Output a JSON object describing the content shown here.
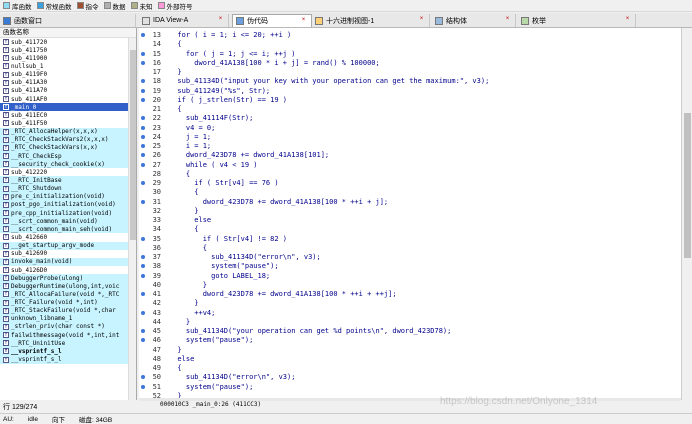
{
  "legend": [
    {
      "label": "库函数",
      "color": "#8fdcf5"
    },
    {
      "label": "常规函数",
      "color": "#3aa0e0"
    },
    {
      "label": "指令",
      "color": "#a05030"
    },
    {
      "label": "数据",
      "color": "#b0b0b0"
    },
    {
      "label": "未知",
      "color": "#b0b088"
    },
    {
      "label": "外部符号",
      "color": "#ff9ad8"
    }
  ],
  "tabs": [
    {
      "label": "函数窗口",
      "icon": "function-window-icon"
    },
    {
      "label": "IDA View-A",
      "icon": "ida-view-icon"
    },
    {
      "label": "伪代码",
      "icon": "pseudocode-icon"
    },
    {
      "label": "十六进制视图-1",
      "icon": "hex-view-icon"
    },
    {
      "label": "结构体",
      "icon": "structures-icon"
    },
    {
      "label": "枚举",
      "icon": "enums-icon"
    }
  ],
  "functions_panel": {
    "header": "函数名称",
    "items": [
      {
        "name": "sub_411720",
        "kind": "normal"
      },
      {
        "name": "sub_411750",
        "kind": "normal"
      },
      {
        "name": "sub_411900",
        "kind": "normal"
      },
      {
        "name": "nullsub_1",
        "kind": "normal"
      },
      {
        "name": "sub_4119F0",
        "kind": "normal"
      },
      {
        "name": "sub_411A30",
        "kind": "normal"
      },
      {
        "name": "sub_411A70",
        "kind": "normal"
      },
      {
        "name": "sub_411AF0",
        "kind": "normal"
      },
      {
        "name": "_main_0",
        "kind": "selected"
      },
      {
        "name": "sub_411EC0",
        "kind": "normal"
      },
      {
        "name": "sub_411F50",
        "kind": "normal"
      },
      {
        "name": "_RTC_AllocaHelper(x,x,x)",
        "kind": "lib"
      },
      {
        "name": "_RTC_CheckStackVars2(x,x,x)",
        "kind": "lib"
      },
      {
        "name": "_RTC_CheckStackVars(x,x)",
        "kind": "lib"
      },
      {
        "name": "__RTC_CheckEsp",
        "kind": "lib"
      },
      {
        "name": "__security_check_cookie(x)",
        "kind": "lib"
      },
      {
        "name": "sub_412220",
        "kind": "normal"
      },
      {
        "name": "__RTC_InitBase",
        "kind": "lib"
      },
      {
        "name": "__RTC_Shutdown",
        "kind": "lib"
      },
      {
        "name": "pre_c_initialization(void)",
        "kind": "lib"
      },
      {
        "name": "post_pgo_initialization(void)",
        "kind": "lib"
      },
      {
        "name": "pre_cpp_initialization(void)",
        "kind": "lib"
      },
      {
        "name": "__scrt_common_main(void)",
        "kind": "lib"
      },
      {
        "name": "__scrt_common_main_seh(void)",
        "kind": "lib"
      },
      {
        "name": "sub_412660",
        "kind": "normal"
      },
      {
        "name": "__get_startup_argv_mode",
        "kind": "lib"
      },
      {
        "name": "sub_412690",
        "kind": "normal"
      },
      {
        "name": "invoke_main(void)",
        "kind": "lib"
      },
      {
        "name": "sub_4126D0",
        "kind": "normal"
      },
      {
        "name": "DebuggerProbe(ulong)",
        "kind": "lib"
      },
      {
        "name": "DebuggerRuntime(ulong,int,voic",
        "kind": "lib"
      },
      {
        "name": "_RTC_AllocaFailure(void *,_RTC",
        "kind": "lib"
      },
      {
        "name": "_RTC_Failure(void *,int)",
        "kind": "lib"
      },
      {
        "name": "_RTC_StackFailure(void *,char",
        "kind": "lib"
      },
      {
        "name": "unknown_libname_1",
        "kind": "lib"
      },
      {
        "name": "_strlen_priv(char const *)",
        "kind": "lib"
      },
      {
        "name": "failwithmessage(void *,int,int",
        "kind": "lib"
      },
      {
        "name": "__RTC_UninitUse",
        "kind": "lib"
      },
      {
        "name": "__vsprintf_s_l",
        "kind": "bold"
      },
      {
        "name": "__vsprintf_s_l",
        "kind": "lib"
      }
    ],
    "row_count": "行 129/274"
  },
  "code_lines": [
    {
      "n": "13",
      "dot": true,
      "t": "  for ( i = 1; i <= 20; ++i )"
    },
    {
      "n": "14",
      "dot": false,
      "t": "  {"
    },
    {
      "n": "15",
      "dot": true,
      "t": "    for ( j = 1; j <= i; ++j )"
    },
    {
      "n": "16",
      "dot": true,
      "t": "      dword_41A138[100 * i + j] = rand() % 100000;"
    },
    {
      "n": "17",
      "dot": false,
      "t": "  }"
    },
    {
      "n": "18",
      "dot": true,
      "t": "  sub_41134D(\"input your key with your operation can get the maximum:\", v3);"
    },
    {
      "n": "19",
      "dot": true,
      "t": "  sub_411249(\"%s\", Str);"
    },
    {
      "n": "20",
      "dot": true,
      "t": "  if ( j_strlen(Str) == 19 )"
    },
    {
      "n": "21",
      "dot": false,
      "t": "  {"
    },
    {
      "n": "22",
      "dot": true,
      "t": "    sub_41114F(Str);"
    },
    {
      "n": "23",
      "dot": true,
      "t": "    v4 = 0;"
    },
    {
      "n": "24",
      "dot": true,
      "t": "    j = 1;"
    },
    {
      "n": "25",
      "dot": true,
      "t": "    i = 1;"
    },
    {
      "n": "26",
      "dot": true,
      "t": "    dword_423D78 += dword_41A138[101];"
    },
    {
      "n": "27",
      "dot": true,
      "t": "    while ( v4 < 19 )"
    },
    {
      "n": "28",
      "dot": false,
      "t": "    {"
    },
    {
      "n": "29",
      "dot": true,
      "t": "      if ( Str[v4] == 76 )"
    },
    {
      "n": "30",
      "dot": false,
      "t": "      {"
    },
    {
      "n": "31",
      "dot": true,
      "t": "        dword_423D78 += dword_41A138[100 * ++i + j];"
    },
    {
      "n": "32",
      "dot": false,
      "t": "      }"
    },
    {
      "n": "33",
      "dot": false,
      "t": "      else"
    },
    {
      "n": "34",
      "dot": false,
      "t": "      {"
    },
    {
      "n": "35",
      "dot": true,
      "t": "        if ( Str[v4] != 82 )"
    },
    {
      "n": "36",
      "dot": false,
      "t": "        {"
    },
    {
      "n": "37",
      "dot": true,
      "t": "          sub_41134D(\"error\\n\", v3);"
    },
    {
      "n": "38",
      "dot": true,
      "t": "          system(\"pause\");"
    },
    {
      "n": "39",
      "dot": true,
      "t": "          goto LABEL_18;"
    },
    {
      "n": "40",
      "dot": false,
      "t": "        }"
    },
    {
      "n": "41",
      "dot": true,
      "t": "        dword_423D78 += dword_41A138[100 * ++i + ++j];"
    },
    {
      "n": "42",
      "dot": false,
      "t": "      }"
    },
    {
      "n": "43",
      "dot": true,
      "t": "      ++v4;"
    },
    {
      "n": "44",
      "dot": false,
      "t": "    }"
    },
    {
      "n": "45",
      "dot": true,
      "t": "    sub_41134D(\"your operation can get %d points\\n\", dword_423D78);"
    },
    {
      "n": "46",
      "dot": true,
      "t": "    system(\"pause\");"
    },
    {
      "n": "47",
      "dot": false,
      "t": "  }"
    },
    {
      "n": "48",
      "dot": false,
      "t": "  else"
    },
    {
      "n": "49",
      "dot": false,
      "t": "  {"
    },
    {
      "n": "50",
      "dot": true,
      "t": "    sub_41134D(\"error\\n\", v3);"
    },
    {
      "n": "51",
      "dot": true,
      "t": "    system(\"pause\");"
    },
    {
      "n": "52",
      "dot": false,
      "t": "  }"
    }
  ],
  "address_line": "000010C3 _main_0:26 (411CC3)",
  "status": {
    "au": "AU:",
    "idle": "idle",
    "direction": "向下",
    "disk": "磁盘: 34GB"
  },
  "watermark": "https://blog.csdn.net/Onlyone_1314"
}
